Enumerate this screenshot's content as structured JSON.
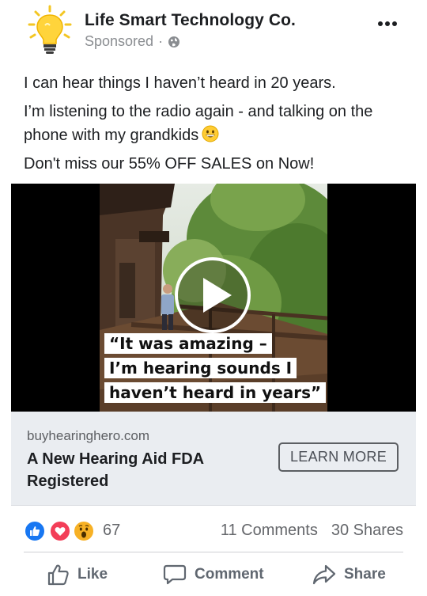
{
  "post": {
    "page_name": "Life Smart Technology Co.",
    "sponsored_label": "Sponsored",
    "separator": "·",
    "avatar_icon": "lightbulb-icon",
    "privacy_icon": "globe-icon",
    "more_icon": "more-options-icon"
  },
  "body": {
    "line1": "I can hear things I haven’t heard in 20 years.",
    "line2": "I’m listening to the radio again - and talking on the phone with my grandkids",
    "line2_emoji": "grinning-face-emoji",
    "line3": "Don't miss our 55% OFF SALES on Now!"
  },
  "video": {
    "caption_lines": [
      "“It was amazing –",
      "I’m hearing sounds I",
      "haven’t heard in years”"
    ],
    "play_icon": "play-icon"
  },
  "link": {
    "domain": "buyhearinghero.com",
    "title": "A New Hearing Aid FDA Registered",
    "cta": "LEARN MORE"
  },
  "stats": {
    "reactions": [
      "like",
      "love",
      "wow"
    ],
    "reaction_count": "67",
    "comments": "11 Comments",
    "shares": "30 Shares"
  },
  "actions": {
    "like": "Like",
    "comment": "Comment",
    "share": "Share"
  },
  "colors": {
    "like_blue": "#1877f2",
    "love_red": "#f33e58",
    "wow_yellow": "#f7b125",
    "card_bg": "#eaedf1",
    "secondary_text": "#65676b"
  }
}
